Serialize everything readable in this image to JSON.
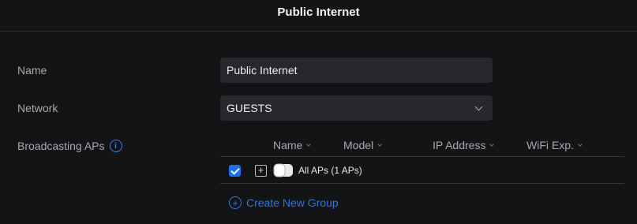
{
  "header": {
    "title": "Public Internet"
  },
  "form": {
    "name_label": "Name",
    "name_value": "Public Internet",
    "network_label": "Network",
    "network_value": "GUESTS",
    "aps_label": "Broadcasting APs",
    "info_glyph": "i"
  },
  "table": {
    "columns": [
      "Name",
      "Model",
      "IP Address",
      "WiFi Exp."
    ],
    "rows": [
      {
        "checked": true,
        "expand_glyph": "+",
        "icon": "access-point-icon",
        "label": "All APs (1 APs)"
      }
    ]
  },
  "actions": {
    "create_group_label": "Create New Group",
    "plus_glyph": "+"
  },
  "colors": {
    "accent": "#2f73e6",
    "checkbox": "#1f6fea",
    "background": "#131416"
  }
}
